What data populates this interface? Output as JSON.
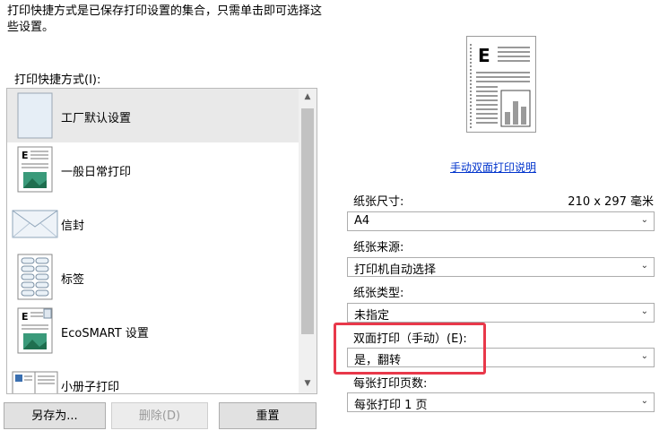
{
  "description": "打印快捷方式是已保存打印设置的集合，只需单击即可选择这些设置。",
  "shortcuts_label": "打印快捷方式(I):",
  "shortcuts": [
    {
      "label": "工厂默认设置",
      "icon": "blank-page-icon",
      "selected": true
    },
    {
      "label": "一般日常打印",
      "icon": "document-picture-icon",
      "selected": false
    },
    {
      "label": "信封",
      "icon": "envelope-icon",
      "selected": false
    },
    {
      "label": "标签",
      "icon": "labels-icon",
      "selected": false
    },
    {
      "label": "EcoSMART 设置",
      "icon": "eco-document-icon",
      "selected": false
    },
    {
      "label": "小册子打印",
      "icon": "booklet-icon",
      "selected": false
    }
  ],
  "buttons": {
    "save_as": "另存为...",
    "delete": "删除(D)",
    "reset": "重置"
  },
  "link": "手动双面打印说明",
  "paper_size": {
    "label": "纸张尺寸:",
    "value": "210 x 297 毫米",
    "selected": "A4"
  },
  "paper_source": {
    "label": "纸张来源:",
    "selected": "打印机自动选择"
  },
  "paper_type": {
    "label": "纸张类型:",
    "selected": "未指定"
  },
  "duplex": {
    "label": "双面打印（手动）(E):",
    "selected": "是，翻转"
  },
  "pages_per_sheet": {
    "label": "每张打印页数:",
    "selected": "每张打印 1 页"
  },
  "colors": {
    "highlight": "#e8384a",
    "link": "#0033cc",
    "selection": "#e9e9e9"
  }
}
